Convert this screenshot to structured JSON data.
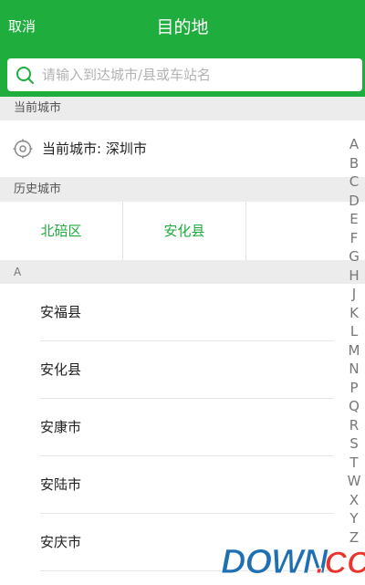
{
  "header": {
    "cancel_label": "取消",
    "title": "目的地"
  },
  "search": {
    "placeholder": "请输入到达城市/县或车站名",
    "value": ""
  },
  "current_section": {
    "header": "当前城市",
    "city_text": "当前城市: 深圳市"
  },
  "history_section": {
    "header": "历史城市",
    "cities": [
      "北碚区",
      "安化县"
    ]
  },
  "a_section": {
    "header": "A",
    "cities": [
      "安福县",
      "安化县",
      "安康市",
      "安陆市",
      "安庆市"
    ]
  },
  "index_letters": [
    "A",
    "B",
    "C",
    "D",
    "E",
    "F",
    "G",
    "H",
    "J",
    "K",
    "L",
    "M",
    "N",
    "P",
    "Q",
    "R",
    "S",
    "T",
    "W",
    "X",
    "Y",
    "Z"
  ],
  "watermark": {
    "text": "DOWN.CC"
  },
  "colors": {
    "accent": "#1fad3e",
    "section_bg": "#ececec"
  },
  "icons": {
    "search": "search-icon",
    "locate": "locate-icon"
  }
}
